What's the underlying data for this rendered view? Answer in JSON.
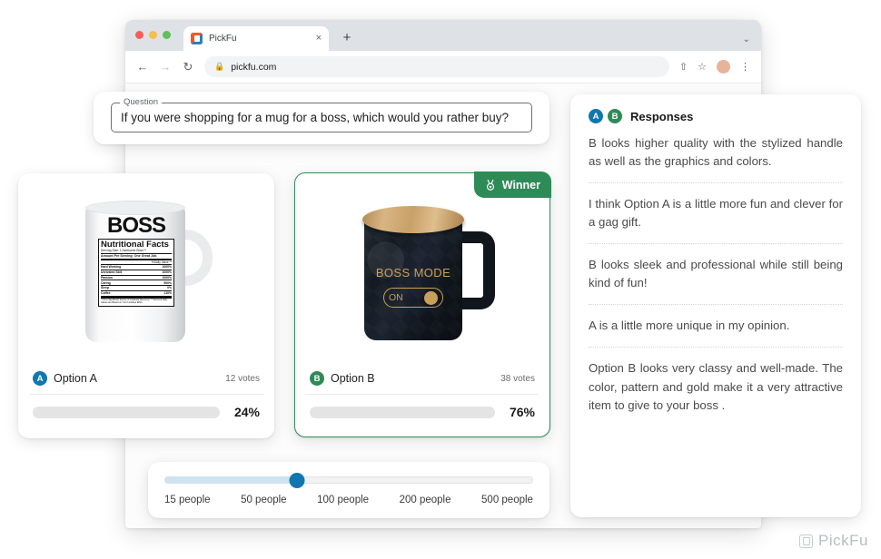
{
  "browser": {
    "tab_title": "PickFu",
    "tab_close": "×",
    "new_tab": "+",
    "tab_menu": "⌄",
    "back": "←",
    "forward": "→",
    "reload": "↻",
    "lock_icon": "🔒",
    "url": "pickfu.com",
    "share_icon": "⇧",
    "bookmark_icon": "☆",
    "menu_icon": "⋮"
  },
  "question": {
    "legend": "Question",
    "value": "If you were shopping for a mug for a boss, which would you rather buy?"
  },
  "options": [
    {
      "badge": "A",
      "label": "Option A",
      "votes": "12 votes",
      "percent": "24%",
      "percent_value": 24,
      "color": "#1077b0",
      "winner": false,
      "image": {
        "headline": "BOSS",
        "nutrition_title": "Nutritional Facts",
        "serving_size": "Serving Size: 1 Awesome Boss™",
        "amount_per_serving": "Amount Per Serving: One Great Job",
        "daily_value_header": "%Daily Value **",
        "rows": [
          {
            "name": "Hard Working",
            "value": "1000%"
          },
          {
            "name": "Unrivaled Skill",
            "value": "1000%"
          },
          {
            "name": "Passion",
            "value": "1000%"
          },
          {
            "name": "Caring",
            "value": "500%"
          },
          {
            "name": "Sleep",
            "value": "0%"
          },
          {
            "name": "Coffee",
            "value": "110%"
          }
        ],
        "footnote": "* Not a Significant Source of Gratitude Received. ** Selected Daily Values are Based on Your Limitless Effort"
      }
    },
    {
      "badge": "B",
      "label": "Option B",
      "votes": "38 votes",
      "percent": "76%",
      "percent_value": 76,
      "color": "#2e8b57",
      "winner": true,
      "winner_label": "Winner",
      "image": {
        "line1": "BOSS MODE",
        "toggle_text": "ON"
      }
    }
  ],
  "audience_slider": {
    "selected": "50 people",
    "ticks": [
      "15 people",
      "50 people",
      "100 people",
      "200 people",
      "500 people"
    ]
  },
  "responses": {
    "badge_a": "A",
    "badge_b": "B",
    "title": "Responses",
    "items": [
      "B looks higher quality with the stylized handle as well as the graphics and colors.",
      "I think Option A is a little more fun and clever for a gag gift.",
      "B looks sleek and professional while still being kind of fun!",
      "A is a little more unique in my opinion.",
      "Option B looks very classy and well-made. The color, pattern and gold make it a very attractive item to give to your boss ."
    ]
  },
  "watermark": {
    "text": "PickFu"
  }
}
